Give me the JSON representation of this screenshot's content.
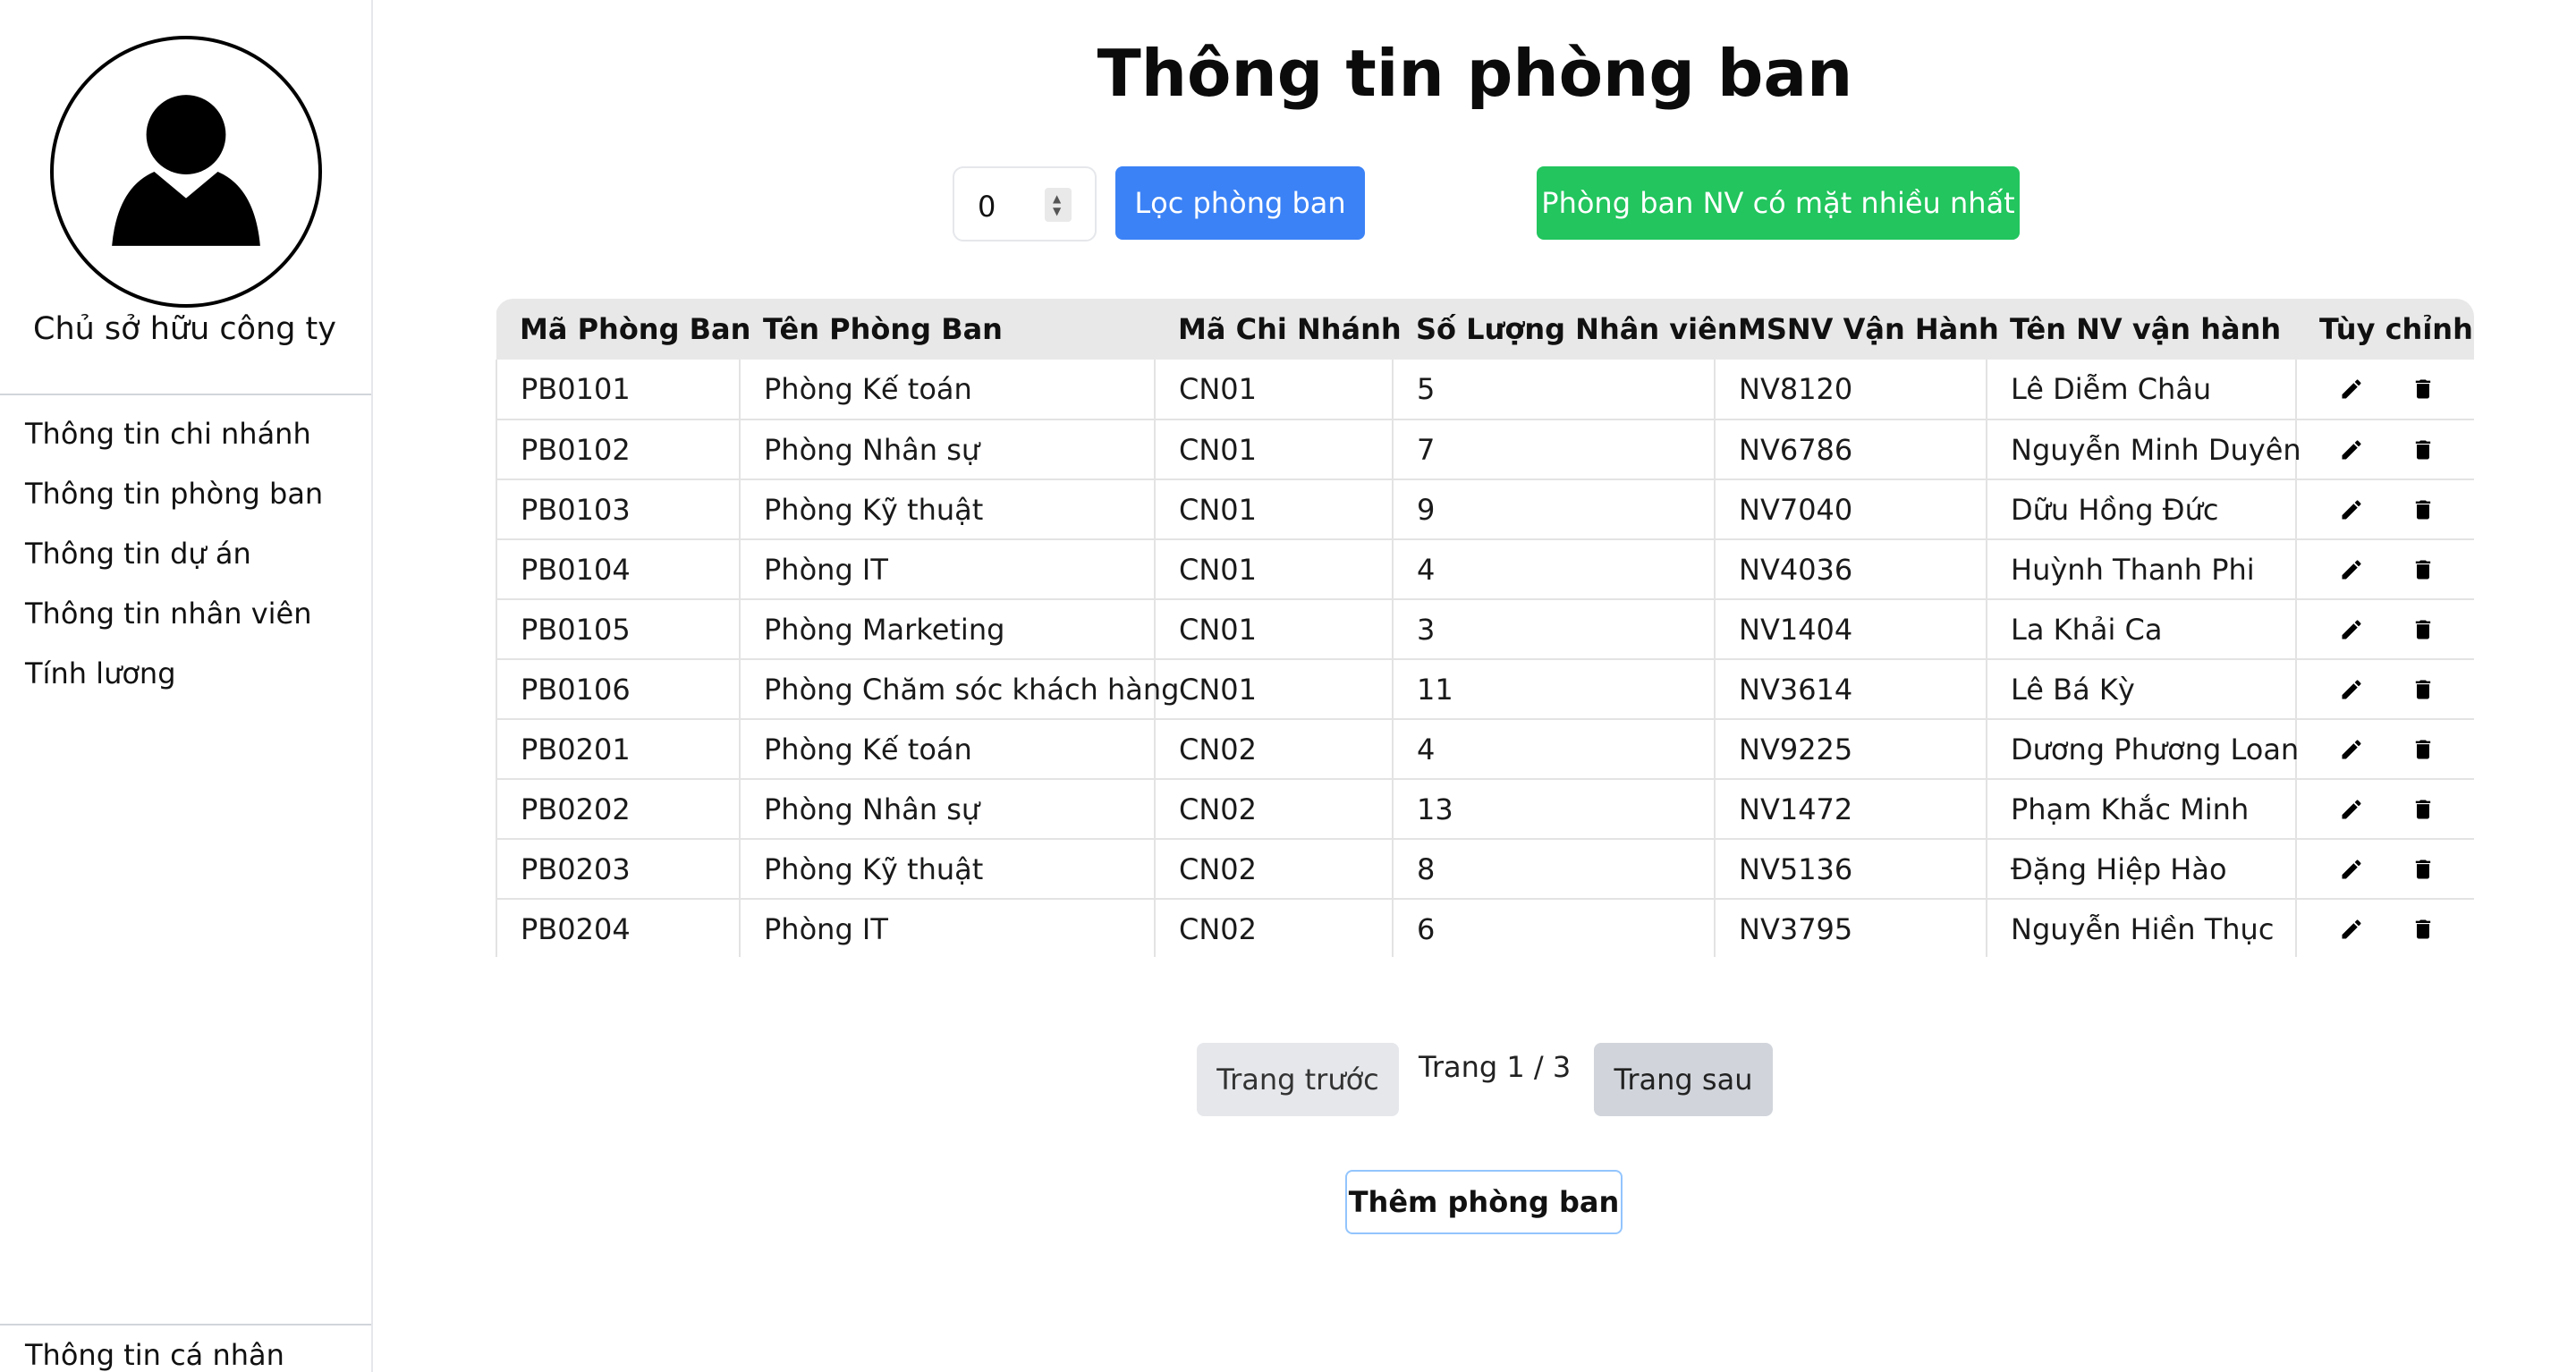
{
  "sidebar": {
    "owner_name": "Chủ sở hữu công ty",
    "nav_items": [
      {
        "label": "Thông tin chi nhánh"
      },
      {
        "label": "Thông tin phòng ban"
      },
      {
        "label": "Thông tin dự án"
      },
      {
        "label": "Thông tin nhân viên"
      },
      {
        "label": "Tính lương"
      }
    ],
    "bottom_item": "Thông tin cá nhân",
    "avatar_icon": "user-icon"
  },
  "main": {
    "title": "Thông tin phòng ban",
    "filter": {
      "value": "0",
      "filter_button": "Lọc phòng ban",
      "most_button": "Phòng ban NV có mặt nhiều nhất"
    },
    "table": {
      "headers": [
        "Mã Phòng Ban",
        "Tên Phòng Ban",
        "Mã Chi Nhánh",
        "Số Lượng Nhân viên",
        "MSNV Vận Hành",
        "Tên NV vận hành",
        "Tùy chỉnh"
      ],
      "rows": [
        [
          "PB0101",
          "Phòng Kế toán",
          "CN01",
          "5",
          "NV8120",
          "Lê Diễm Châu"
        ],
        [
          "PB0102",
          "Phòng Nhân sự",
          "CN01",
          "7",
          "NV6786",
          "Nguyễn Minh Duyên"
        ],
        [
          "PB0103",
          "Phòng Kỹ thuật",
          "CN01",
          "9",
          "NV7040",
          "Dữu Hồng Đức"
        ],
        [
          "PB0104",
          "Phòng IT",
          "CN01",
          "4",
          "NV4036",
          "Huỳnh Thanh Phi"
        ],
        [
          "PB0105",
          "Phòng Marketing",
          "CN01",
          "3",
          "NV1404",
          "La Khải Ca"
        ],
        [
          "PB0106",
          "Phòng Chăm sóc khách hàng",
          "CN01",
          "11",
          "NV3614",
          "Lê Bá Kỳ"
        ],
        [
          "PB0201",
          "Phòng Kế toán",
          "CN02",
          "4",
          "NV9225",
          "Dương Phương Loan"
        ],
        [
          "PB0202",
          "Phòng Nhân sự",
          "CN02",
          "13",
          "NV1472",
          "Phạm Khắc Minh"
        ],
        [
          "PB0203",
          "Phòng Kỹ thuật",
          "CN02",
          "8",
          "NV5136",
          "Đặng Hiệp Hào"
        ],
        [
          "PB0204",
          "Phòng IT",
          "CN02",
          "6",
          "NV3795",
          "Nguyễn Hiền Thục"
        ]
      ],
      "action_icons": [
        "pencil-icon",
        "trash-icon"
      ]
    },
    "pagination": {
      "prev_label": "Trang trước",
      "page_info": "Trang 1 / 3",
      "next_label": "Trang sau"
    },
    "add_button": "Thêm phòng ban"
  },
  "colors": {
    "primary_blue": "#3b82f6",
    "success_green": "#22c55e",
    "header_gray": "#e8e8e8"
  }
}
